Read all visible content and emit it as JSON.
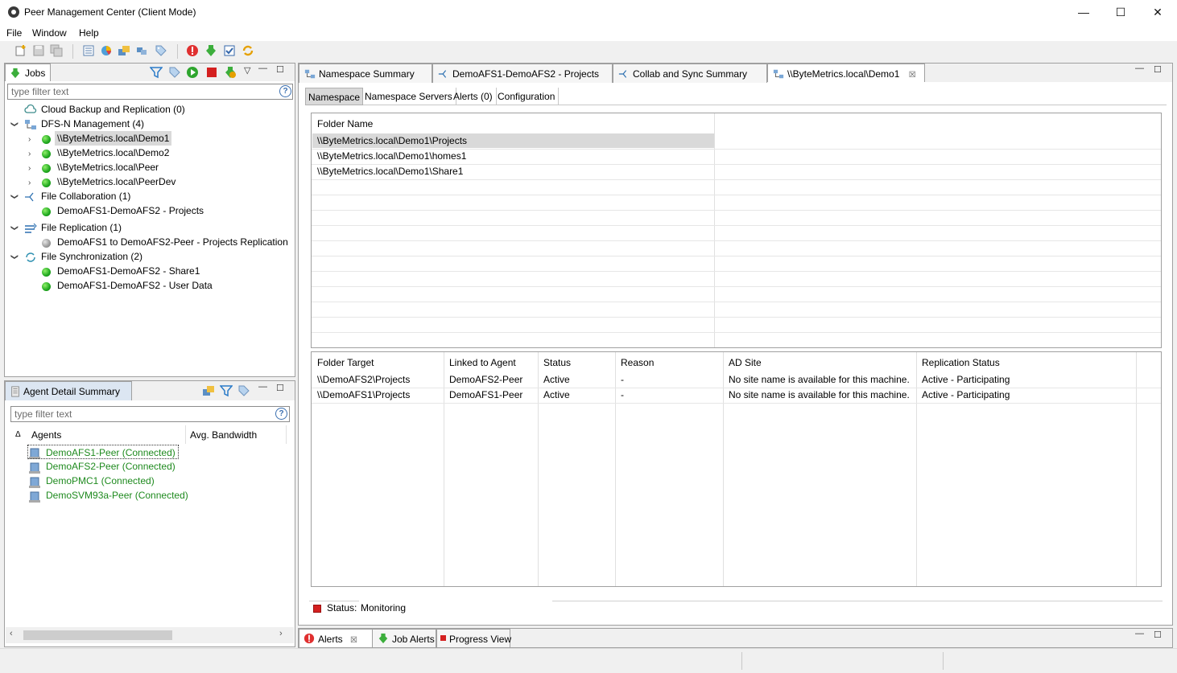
{
  "window": {
    "title": "Peer Management Center (Client Mode)",
    "minimize": "—",
    "maximize": "☐",
    "close": "✕"
  },
  "menu": [
    "File",
    "Window",
    "Help"
  ],
  "jobs_panel": {
    "tab_label": "Jobs",
    "filter_placeholder": "type filter text",
    "tree": [
      {
        "label": "Cloud Backup and Replication (0)"
      },
      {
        "label": "DFS-N Management (4)"
      },
      {
        "label": "\\\\ByteMetrics.local\\Demo1"
      },
      {
        "label": "\\\\ByteMetrics.local\\Demo2"
      },
      {
        "label": "\\\\ByteMetrics.local\\Peer"
      },
      {
        "label": "\\\\ByteMetrics.local\\PeerDev"
      },
      {
        "label": "File Collaboration (1)"
      },
      {
        "label": "DemoAFS1-DemoAFS2 - Projects"
      },
      {
        "label": "File Replication (1)"
      },
      {
        "label": "DemoAFS1 to DemoAFS2-Peer - Projects Replication"
      },
      {
        "label": "File Synchronization (2)"
      },
      {
        "label": "DemoAFS1-DemoAFS2 - Share1"
      },
      {
        "label": "DemoAFS1-DemoAFS2 - User Data"
      }
    ]
  },
  "agent_panel": {
    "tab_label": "Agent Detail Summary",
    "filter_placeholder": "type filter text",
    "col_agents": "Agents",
    "col_bandwidth": "Avg. Bandwidth",
    "sort_indicator": "Δ",
    "agents": [
      "DemoAFS1-Peer (Connected)",
      "DemoAFS2-Peer (Connected)",
      "DemoPMC1 (Connected)",
      "DemoSVM93a-Peer (Connected)"
    ],
    "colors": {
      "connected": "#1e8a1e"
    }
  },
  "editor_tabs": [
    "Namespace Summary",
    "DemoAFS1-DemoAFS2 - Projects",
    "Collab and Sync Summary",
    "\\\\ByteMetrics.local\\Demo1"
  ],
  "sub_tabs": [
    "Namespace",
    "Namespace Servers",
    "Alerts (0)",
    "Configuration"
  ],
  "folder_table": {
    "header": "Folder Name",
    "rows": [
      "\\\\ByteMetrics.local\\Demo1\\Projects",
      "\\\\ByteMetrics.local\\Demo1\\homes1",
      "\\\\ByteMetrics.local\\Demo1\\Share1"
    ]
  },
  "target_table": {
    "headers": [
      "Folder Target",
      "Linked to Agent",
      "Status",
      "Reason",
      "AD Site",
      "Replication Status"
    ],
    "rows": [
      [
        "\\\\DemoAFS2\\Projects",
        "DemoAFS2-Peer",
        "Active",
        "-",
        "No site name is available for this machine.",
        "Active - Participating"
      ],
      [
        "\\\\DemoAFS1\\Projects",
        "DemoAFS1-Peer",
        "Active",
        "-",
        "No site name is available for this machine.",
        "Active - Participating"
      ]
    ]
  },
  "status": {
    "label": "Status:",
    "value": "Monitoring"
  },
  "bottom_tabs": [
    "Alerts",
    "Job Alerts",
    "Progress View"
  ]
}
